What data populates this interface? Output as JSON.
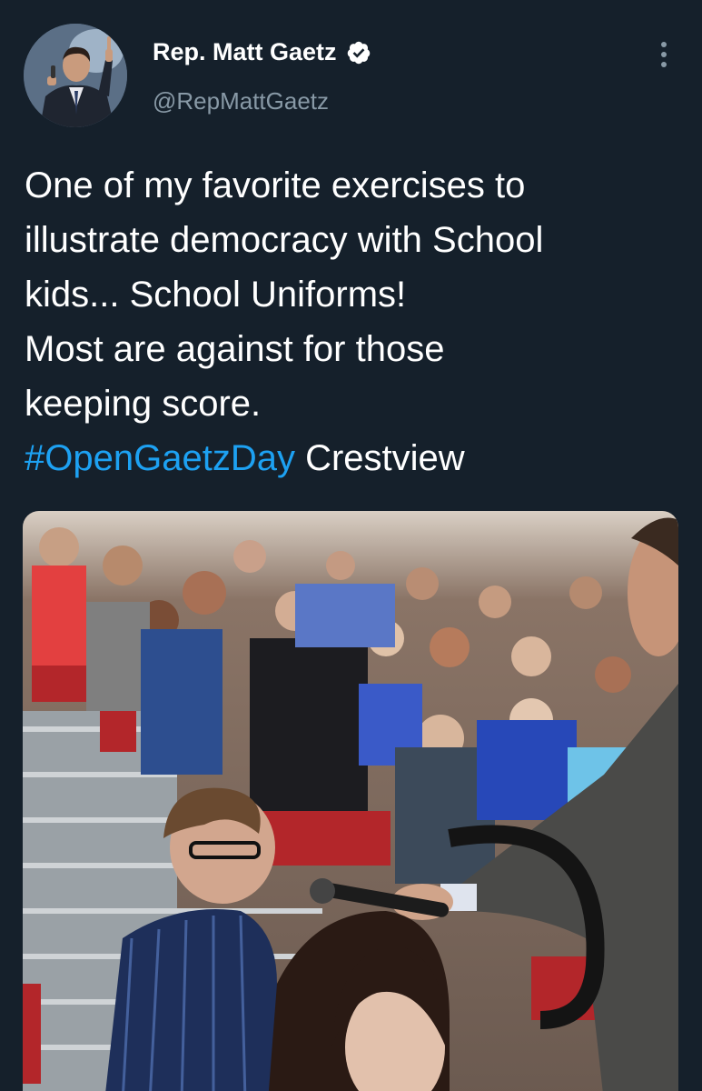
{
  "author": {
    "display_name": "Rep. Matt Gaetz",
    "handle": "@RepMattGaetz",
    "verified": true,
    "avatar_icon": "profile-photo"
  },
  "tweet": {
    "text_lines": [
      "One of my favorite exercises to",
      "illustrate democracy with School",
      "kids... School Uniforms!",
      "Most are against for those",
      "keeping score."
    ],
    "hashtag": "#OpenGaetzDay",
    "place_text": "Crestview"
  },
  "media": {
    "kind": "photo"
  },
  "colors": {
    "background": "#15202b",
    "text": "#ffffff",
    "secondary_text": "#8899a6",
    "link": "#1da1f2"
  },
  "icons": {
    "more": "more-vertical-icon",
    "verified": "verified-badge-icon"
  }
}
